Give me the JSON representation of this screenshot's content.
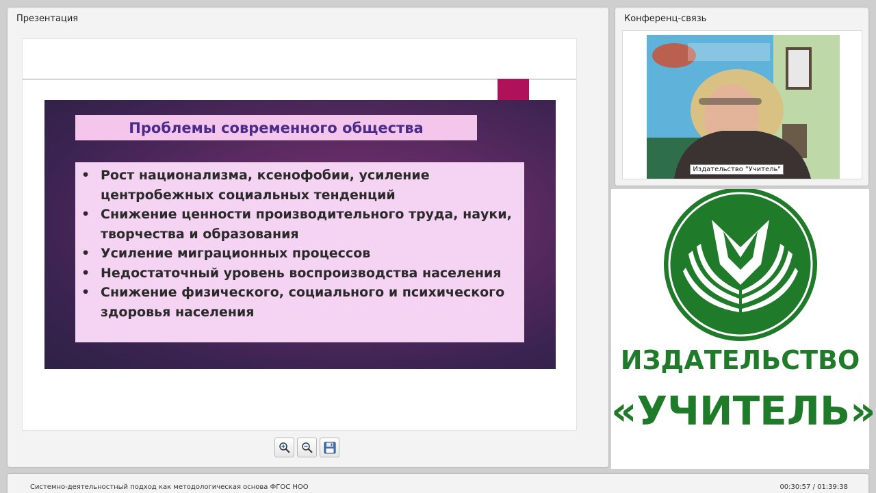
{
  "presentation": {
    "panel_title": "Презентация",
    "slide": {
      "title": "Проблемы современного общества",
      "items": [
        "Рост национализма, ксенофобии, усиление центробежных социальных тенденций",
        "Снижение ценности производительного труда, науки, творчества и образования",
        "Усиление миграционных процессов",
        "Недостаточный уровень воспроизводства населения",
        "Снижение физического, социального и психического здоровья населения"
      ],
      "bullet": "•"
    },
    "toolbar": {
      "zoom_in_icon": "zoom-in-icon",
      "zoom_out_icon": "zoom-out-icon",
      "save_icon": "floppy-disk-icon"
    }
  },
  "conference": {
    "panel_title": "Конференц-связь",
    "participant_label": "Издательство \"Учитель\""
  },
  "logo": {
    "line1": "ИЗДАТЕЛЬСТВО",
    "line2": "«УЧИТЕЛЬ»",
    "color": "#1f7a2a"
  },
  "footer": {
    "lecture_title": "Системно-деятельностный подход как методологическая основа ФГОС НОО",
    "time": "00:30:57 / 01:39:38"
  }
}
